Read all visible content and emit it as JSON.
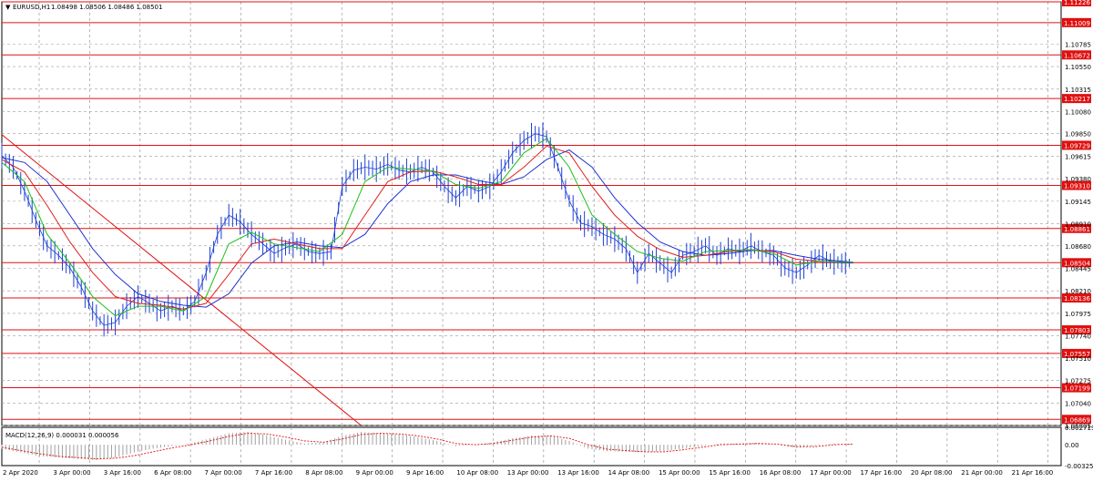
{
  "chart_data": [
    {
      "type": "line",
      "symbol": "EURUSD,H1",
      "header_values": [
        "1.08498",
        "1.08506",
        "1.08486",
        "1.08501"
      ],
      "ylim": [
        1.06805,
        1.11226
      ],
      "y_ticks": [
        "1.10785",
        "1.10550",
        "1.10315",
        "1.10080",
        "1.09850",
        "1.09615",
        "1.09380",
        "1.09145",
        "1.08910",
        "1.08680",
        "1.08445",
        "1.08210",
        "1.07975",
        "1.07740",
        "1.07510",
        "1.07275",
        "1.07040",
        "1.06805"
      ],
      "x_labels": [
        "2 Apr 2020",
        "3 Apr 00:00",
        "3 Apr 16:00",
        "6 Apr 08:00",
        "7 Apr 00:00",
        "7 Apr 16:00",
        "8 Apr 08:00",
        "9 Apr 00:00",
        "9 Apr 16:00",
        "10 Apr 08:00",
        "13 Apr 00:00",
        "13 Apr 16:00",
        "14 Apr 08:00",
        "15 Apr 00:00",
        "15 Apr 16:00",
        "16 Apr 08:00",
        "17 Apr 00:00",
        "17 Apr 16:00",
        "20 Apr 08:00",
        "21 Apr 00:00",
        "21 Apr 16:00"
      ],
      "horizontal_levels": [
        "1.11226",
        "1.11009",
        "1.10672",
        "1.10217",
        "1.09729",
        "1.09310",
        "1.08861",
        "1.08504",
        "1.08136",
        "1.07803",
        "1.07557",
        "1.07199",
        "1.06869"
      ],
      "trendline": {
        "start": [
          0,
          1.0984
        ],
        "end": [
          95,
          1.06805
        ]
      },
      "price_path": [
        [
          0,
          1.0962
        ],
        [
          3,
          1.095
        ],
        [
          6,
          1.0925
        ],
        [
          9,
          1.0895
        ],
        [
          12,
          1.0868
        ],
        [
          15,
          1.0858
        ],
        [
          18,
          1.0845
        ],
        [
          21,
          1.0825
        ],
        [
          24,
          1.08
        ],
        [
          27,
          1.0785
        ],
        [
          30,
          1.0788
        ],
        [
          33,
          1.0805
        ],
        [
          36,
          1.0815
        ],
        [
          39,
          1.0808
        ],
        [
          42,
          1.08
        ],
        [
          45,
          1.0805
        ],
        [
          48,
          1.08
        ],
        [
          51,
          1.081
        ],
        [
          54,
          1.084
        ],
        [
          57,
          1.088
        ],
        [
          60,
          1.09
        ],
        [
          63,
          1.0893
        ],
        [
          66,
          1.088
        ],
        [
          69,
          1.087
        ],
        [
          72,
          1.086
        ],
        [
          75,
          1.0866
        ],
        [
          78,
          1.087
        ],
        [
          81,
          1.0862
        ],
        [
          84,
          1.086
        ],
        [
          87,
          1.0862
        ],
        [
          90,
          1.093
        ],
        [
          93,
          1.0947
        ],
        [
          96,
          1.095
        ],
        [
          99,
          1.0948
        ],
        [
          102,
          1.0953
        ],
        [
          105,
          1.0947
        ],
        [
          108,
          1.0945
        ],
        [
          111,
          1.095
        ],
        [
          114,
          1.0945
        ],
        [
          117,
          1.093
        ],
        [
          120,
          1.0918
        ],
        [
          123,
          1.093
        ],
        [
          126,
          1.0925
        ],
        [
          129,
          1.093
        ],
        [
          132,
          1.0945
        ],
        [
          135,
          1.0965
        ],
        [
          138,
          1.0978
        ],
        [
          141,
          1.0985
        ],
        [
          144,
          1.0982
        ],
        [
          147,
          1.095
        ],
        [
          150,
          1.0915
        ],
        [
          153,
          1.0892
        ],
        [
          156,
          1.0888
        ],
        [
          159,
          1.088
        ],
        [
          162,
          1.0875
        ],
        [
          165,
          1.0865
        ],
        [
          168,
          1.084
        ],
        [
          171,
          1.086
        ],
        [
          174,
          1.085
        ],
        [
          177,
          1.084
        ],
        [
          180,
          1.0858
        ],
        [
          183,
          1.0862
        ],
        [
          186,
          1.0868
        ],
        [
          189,
          1.0858
        ],
        [
          192,
          1.0865
        ],
        [
          195,
          1.0862
        ],
        [
          198,
          1.0868
        ],
        [
          201,
          1.0862
        ],
        [
          204,
          1.0858
        ],
        [
          207,
          1.0845
        ],
        [
          210,
          1.084
        ],
        [
          213,
          1.0848
        ],
        [
          216,
          1.0858
        ],
        [
          219,
          1.0852
        ],
        [
          222,
          1.085
        ],
        [
          225,
          1.085
        ]
      ],
      "ma_fast": [
        [
          0,
          1.0955
        ],
        [
          6,
          1.0935
        ],
        [
          12,
          1.088
        ],
        [
          18,
          1.085
        ],
        [
          24,
          1.0815
        ],
        [
          30,
          1.0795
        ],
        [
          36,
          1.0805
        ],
        [
          42,
          1.0805
        ],
        [
          48,
          1.08
        ],
        [
          54,
          1.0815
        ],
        [
          60,
          1.087
        ],
        [
          66,
          1.0882
        ],
        [
          72,
          1.087
        ],
        [
          78,
          1.0866
        ],
        [
          84,
          1.0862
        ],
        [
          90,
          1.088
        ],
        [
          96,
          1.0935
        ],
        [
          102,
          1.095
        ],
        [
          108,
          1.0948
        ],
        [
          114,
          1.0946
        ],
        [
          120,
          1.0932
        ],
        [
          126,
          1.0928
        ],
        [
          132,
          1.0935
        ],
        [
          138,
          1.0965
        ],
        [
          144,
          1.098
        ],
        [
          150,
          1.095
        ],
        [
          156,
          1.09
        ],
        [
          162,
          1.088
        ],
        [
          168,
          1.0862
        ],
        [
          174,
          1.0855
        ],
        [
          180,
          1.0852
        ],
        [
          186,
          1.0862
        ],
        [
          192,
          1.0863
        ],
        [
          198,
          1.0864
        ],
        [
          204,
          1.086
        ],
        [
          210,
          1.0848
        ],
        [
          216,
          1.0852
        ],
        [
          222,
          1.0851
        ],
        [
          225,
          1.0851
        ]
      ],
      "ma_mid": [
        [
          0,
          1.0958
        ],
        [
          6,
          1.0945
        ],
        [
          12,
          1.091
        ],
        [
          18,
          1.0872
        ],
        [
          24,
          1.084
        ],
        [
          30,
          1.0815
        ],
        [
          36,
          1.0808
        ],
        [
          42,
          1.0806
        ],
        [
          48,
          1.0802
        ],
        [
          54,
          1.0808
        ],
        [
          60,
          1.0838
        ],
        [
          66,
          1.087
        ],
        [
          72,
          1.0875
        ],
        [
          78,
          1.087
        ],
        [
          84,
          1.0865
        ],
        [
          90,
          1.0865
        ],
        [
          96,
          1.09
        ],
        [
          102,
          1.0935
        ],
        [
          108,
          1.0945
        ],
        [
          114,
          1.0946
        ],
        [
          120,
          1.094
        ],
        [
          126,
          1.0932
        ],
        [
          132,
          1.0932
        ],
        [
          138,
          1.095
        ],
        [
          144,
          1.0972
        ],
        [
          150,
          1.0965
        ],
        [
          156,
          1.093
        ],
        [
          162,
          1.09
        ],
        [
          168,
          1.0878
        ],
        [
          174,
          1.0864
        ],
        [
          180,
          1.0856
        ],
        [
          186,
          1.0858
        ],
        [
          192,
          1.0862
        ],
        [
          198,
          1.0864
        ],
        [
          204,
          1.0862
        ],
        [
          210,
          1.0854
        ],
        [
          216,
          1.0852
        ],
        [
          222,
          1.0851
        ],
        [
          225,
          1.0851
        ]
      ],
      "ma_slow": [
        [
          0,
          1.096
        ],
        [
          6,
          1.0955
        ],
        [
          12,
          1.0935
        ],
        [
          18,
          1.09
        ],
        [
          24,
          1.0865
        ],
        [
          30,
          1.0838
        ],
        [
          36,
          1.0818
        ],
        [
          42,
          1.081
        ],
        [
          48,
          1.0806
        ],
        [
          54,
          1.0804
        ],
        [
          60,
          1.0818
        ],
        [
          66,
          1.085
        ],
        [
          72,
          1.0868
        ],
        [
          78,
          1.0872
        ],
        [
          84,
          1.0868
        ],
        [
          90,
          1.0866
        ],
        [
          96,
          1.088
        ],
        [
          102,
          1.0912
        ],
        [
          108,
          1.0935
        ],
        [
          114,
          1.0942
        ],
        [
          120,
          1.0942
        ],
        [
          126,
          1.0936
        ],
        [
          132,
          1.0932
        ],
        [
          138,
          1.094
        ],
        [
          144,
          1.0958
        ],
        [
          150,
          1.0968
        ],
        [
          156,
          1.095
        ],
        [
          162,
          1.0918
        ],
        [
          168,
          1.0892
        ],
        [
          174,
          1.0872
        ],
        [
          180,
          1.0862
        ],
        [
          186,
          1.0858
        ],
        [
          192,
          1.086
        ],
        [
          198,
          1.0863
        ],
        [
          204,
          1.0863
        ],
        [
          210,
          1.0858
        ],
        [
          216,
          1.0854
        ],
        [
          222,
          1.0852
        ],
        [
          225,
          1.0851
        ]
      ]
    },
    {
      "type": "bar",
      "title": "MACD(12,26,9) 0.000031 0.000056",
      "ylim": [
        -0.003253,
        0.002719
      ],
      "y_ticks": [
        "0.002719",
        "0.00",
        "-0.003253"
      ],
      "histogram": [
        [
          0,
          -0.0006
        ],
        [
          5,
          -0.0012
        ],
        [
          10,
          -0.0018
        ],
        [
          15,
          -0.002
        ],
        [
          20,
          -0.0022
        ],
        [
          25,
          -0.0024
        ],
        [
          30,
          -0.002
        ],
        [
          35,
          -0.0012
        ],
        [
          40,
          -0.0006
        ],
        [
          45,
          -0.0002
        ],
        [
          50,
          0.0002
        ],
        [
          55,
          0.001
        ],
        [
          60,
          0.0018
        ],
        [
          65,
          0.002
        ],
        [
          70,
          0.0015
        ],
        [
          75,
          0.0008
        ],
        [
          80,
          0.0002
        ],
        [
          85,
          0.0004
        ],
        [
          90,
          0.0014
        ],
        [
          95,
          0.002
        ],
        [
          100,
          0.0018
        ],
        [
          105,
          0.0016
        ],
        [
          110,
          0.0012
        ],
        [
          115,
          0.0006
        ],
        [
          120,
          -0.0002
        ],
        [
          125,
          0.0
        ],
        [
          130,
          0.0004
        ],
        [
          135,
          0.001
        ],
        [
          140,
          0.0014
        ],
        [
          145,
          0.0014
        ],
        [
          150,
          0.0006
        ],
        [
          155,
          -0.0006
        ],
        [
          160,
          -0.001
        ],
        [
          165,
          -0.0011
        ],
        [
          170,
          -0.0012
        ],
        [
          175,
          -0.001
        ],
        [
          180,
          -0.0006
        ],
        [
          185,
          -0.0002
        ],
        [
          190,
          0.0002
        ],
        [
          195,
          0.0002
        ],
        [
          200,
          0.0003
        ],
        [
          205,
          0.0
        ],
        [
          210,
          -0.0005
        ],
        [
          215,
          -0.0002
        ],
        [
          220,
          0.0002
        ],
        [
          225,
          0.0001
        ]
      ],
      "signal": [
        [
          0,
          -0.0004
        ],
        [
          5,
          -0.0009
        ],
        [
          10,
          -0.0014
        ],
        [
          15,
          -0.0018
        ],
        [
          20,
          -0.002
        ],
        [
          25,
          -0.0022
        ],
        [
          30,
          -0.0021
        ],
        [
          35,
          -0.0017
        ],
        [
          40,
          -0.0011
        ],
        [
          45,
          -0.0005
        ],
        [
          50,
          0.0
        ],
        [
          55,
          0.0006
        ],
        [
          60,
          0.0013
        ],
        [
          65,
          0.0018
        ],
        [
          70,
          0.0017
        ],
        [
          75,
          0.0012
        ],
        [
          80,
          0.0006
        ],
        [
          85,
          0.0004
        ],
        [
          90,
          0.0009
        ],
        [
          95,
          0.0016
        ],
        [
          100,
          0.0018
        ],
        [
          105,
          0.0017
        ],
        [
          110,
          0.0014
        ],
        [
          115,
          0.0009
        ],
        [
          120,
          0.0002
        ],
        [
          125,
          0.0
        ],
        [
          130,
          0.0002
        ],
        [
          135,
          0.0007
        ],
        [
          140,
          0.0012
        ],
        [
          145,
          0.0014
        ],
        [
          150,
          0.001
        ],
        [
          155,
          0.0
        ],
        [
          160,
          -0.0007
        ],
        [
          165,
          -0.0009
        ],
        [
          170,
          -0.0011
        ],
        [
          175,
          -0.0011
        ],
        [
          180,
          -0.0008
        ],
        [
          185,
          -0.0004
        ],
        [
          190,
          0.0
        ],
        [
          195,
          0.0001
        ],
        [
          200,
          0.0002
        ],
        [
          205,
          0.0001
        ],
        [
          210,
          -0.0003
        ],
        [
          215,
          -0.0003
        ],
        [
          220,
          0.0
        ],
        [
          225,
          0.0001
        ]
      ]
    }
  ],
  "colors": {
    "price": "#1c3fd6",
    "ma_fast": "#18c018",
    "ma_mid": "#e02020",
    "ma_slow": "#2030d0",
    "level": "#e01010",
    "level_label_bg": "#e01010",
    "macd_hist": "#a0a0a0",
    "macd_signal": "#e01010",
    "grid": "#9a9a9a"
  }
}
